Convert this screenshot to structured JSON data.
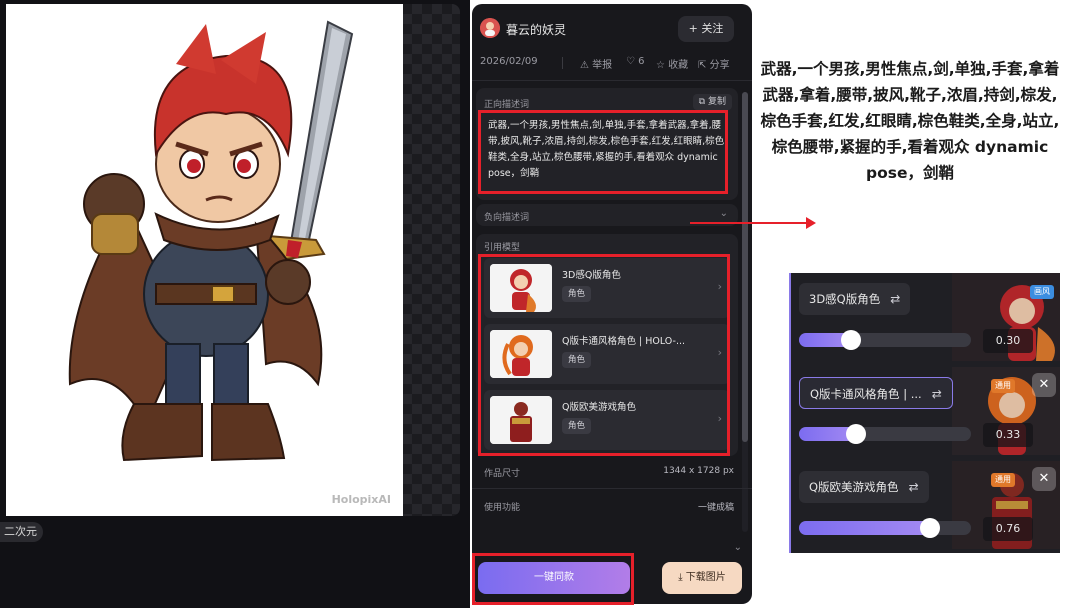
{
  "viewer": {
    "watermark": "HolopixAI",
    "tag_chip": "二次元"
  },
  "panel": {
    "author_name": "暮云的妖灵",
    "follow_label": "+ 关注",
    "date": "2026/02/09",
    "report_label": "举报",
    "like_count": "6",
    "favorite_label": "收藏",
    "share_label": "分享",
    "positive_prompt": {
      "title": "正向描述词",
      "copy_label": "复制",
      "text": "武器,一个男孩,男性焦点,剑,单独,手套,拿着武器,拿着,腰带,披风,靴子,浓眉,持剑,棕发,棕色手套,红发,红眼睛,棕色鞋类,全身,站立,棕色腰带,紧握的手,看着观众 dynamic pose，剑鞘"
    },
    "negative_prompt": {
      "title": "负向描述词"
    },
    "models": {
      "title": "引用模型",
      "items": [
        {
          "name": "3D感Q版角色",
          "badge": "角色"
        },
        {
          "name": "Q版卡通风格角色 | HOLO-...",
          "badge": "角色"
        },
        {
          "name": "Q版欧美游戏角色",
          "badge": "角色"
        }
      ]
    },
    "size": {
      "label": "作品尺寸",
      "value": "1344 x 1728 px"
    },
    "feature": {
      "label": "使用功能",
      "value": "一键成稿"
    },
    "btn_same": "一键同款",
    "btn_download": "下载图片"
  },
  "annotation": {
    "text": "武器,一个男孩,男性焦点,剑,单独,手套,拿着武器,拿着,腰带,披风,靴子,浓眉,持剑,棕发,棕色手套,红发,红眼睛,棕色鞋类,全身,站立,棕色腰带,紧握的手,看着观众 dynamic pose，剑鞘",
    "lora": [
      {
        "name": "3D感Q版角色",
        "value": "0.30",
        "weight": 0.3,
        "badge": "画风",
        "badge_color": "#3b8de0"
      },
      {
        "name": "Q版卡通风格角色 | ...",
        "value": "0.33",
        "weight": 0.33,
        "badge": "通用",
        "badge_color": "#e0782a"
      },
      {
        "name": "Q版欧美游戏角色",
        "value": "0.76",
        "weight": 0.76,
        "badge": "通用",
        "badge_color": "#e0782a"
      }
    ]
  },
  "colors": {
    "highlight": "#e6202a",
    "accent": "#8a7ae8",
    "panel_bg": "#18181c"
  }
}
